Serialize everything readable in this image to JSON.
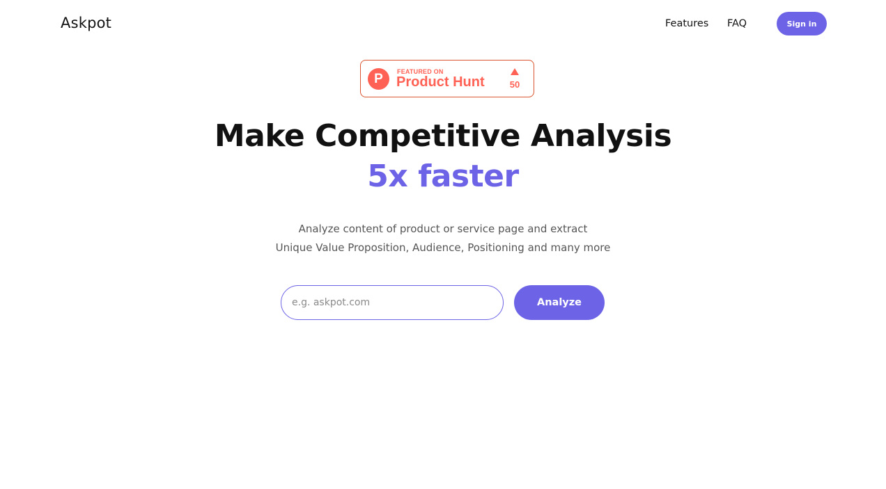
{
  "header": {
    "logo": "Askpot",
    "nav": [
      "Features",
      "FAQ"
    ],
    "signin_label": "Sign in"
  },
  "product_hunt": {
    "logo_letter": "P",
    "featured_label": "FEATURED ON",
    "name": "Product Hunt",
    "upvotes": "50",
    "icon": "upvote-arrow-icon"
  },
  "hero": {
    "title": "Make Competitive Analysis",
    "accent": "5x faster",
    "subtitle_line1": "Analyze content of product or service page and extract",
    "subtitle_line2": "Unique Value Proposition, Audience, Positioning and many more"
  },
  "form": {
    "placeholder": "e.g. askpot.com",
    "value": "",
    "button_label": "Analyze"
  },
  "colors": {
    "accent": "#6c63e6",
    "product_hunt": "#ff6154"
  }
}
